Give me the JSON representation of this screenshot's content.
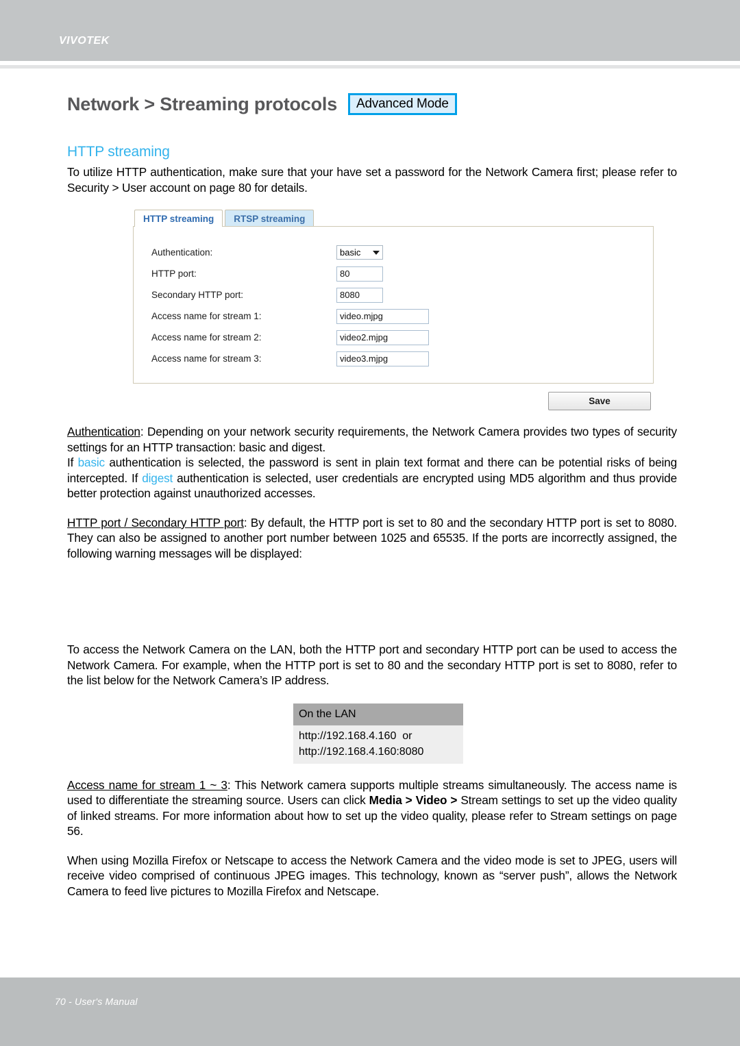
{
  "header": {
    "brand": "VIVOTEK"
  },
  "footer": {
    "page_label": "70 - User's Manual"
  },
  "page": {
    "title": "Network > Streaming protocols",
    "mode_badge": "Advanced Mode",
    "section_heading": "HTTP streaming",
    "intro": "To utilize HTTP authentication, make sure that your have set a password for the Network Camera first; please refer to Security > User account on page 80 for details."
  },
  "ui_screenshot": {
    "tabs": [
      {
        "label": "HTTP streaming",
        "active": true
      },
      {
        "label": "RTSP streaming",
        "active": false
      }
    ],
    "fields": {
      "authentication_label": "Authentication:",
      "authentication_value": "basic",
      "http_port_label": "HTTP port:",
      "http_port_value": "80",
      "secondary_http_port_label": "Secondary HTTP port:",
      "secondary_http_port_value": "8080",
      "stream1_label": "Access name for stream 1:",
      "stream1_value": "video.mjpg",
      "stream2_label": "Access name for stream 2:",
      "stream2_value": "video2.mjpg",
      "stream3_label": "Access name for stream 3:",
      "stream3_value": "video3.mjpg"
    },
    "save_label": "Save"
  },
  "body": {
    "auth_term": "Authentication",
    "auth_p1": ": Depending on your network security requirements, the Network Camera provides two types of security settings for an HTTP transaction: basic and digest.",
    "auth_p2_a": "If ",
    "auth_p2_basic": "basic",
    "auth_p2_b": " authentication is selected, the password is sent in plain text format and there can be potential risks of being intercepted. If ",
    "auth_p2_digest": "digest",
    "auth_p2_c": " authentication is selected, user credentials are encrypted using MD5 algorithm and thus provide better protection against unauthorized accesses.",
    "port_term": "HTTP port / Secondary HTTP port",
    "port_p": ": By default, the HTTP port is set to 80 and the secondary HTTP port is set to 8080. They can also be assigned to another port number between 1025 and 65535. If the ports are incorrectly assigned, the following warning messages will be displayed:",
    "lan_p": "To access the Network Camera on the LAN, both the HTTP port and secondary HTTP port can be used to access the Network Camera. For example, when the HTTP port is set to 80 and the secondary HTTP port is set to 8080, refer to the list below for the Network Camera’s IP address.",
    "stream_term": "Access name for stream 1 ~ 3",
    "stream_p_a": ": This Network camera supports multiple streams simultaneously. The access name is used to differentiate the streaming source. Users can click ",
    "stream_p_bold": "Media > Video >",
    "stream_p_b": " Stream settings to set up the video quality of linked streams. For more information about how to set up the video quality, please refer to Stream settings on page 56.",
    "firefox_p": "When using Mozilla Firefox or  Netscape to access the Network Camera and the video mode is set to JPEG, users will receive video comprised of continuous JPEG images. This technology, known as “server push”, allows the Network Camera to feed live pictures to Mozilla Firefox and Netscape."
  },
  "lan_table": {
    "header": "On the LAN",
    "rows": [
      "http://192.168.4.160  or",
      "http://192.168.4.160:8080"
    ]
  }
}
